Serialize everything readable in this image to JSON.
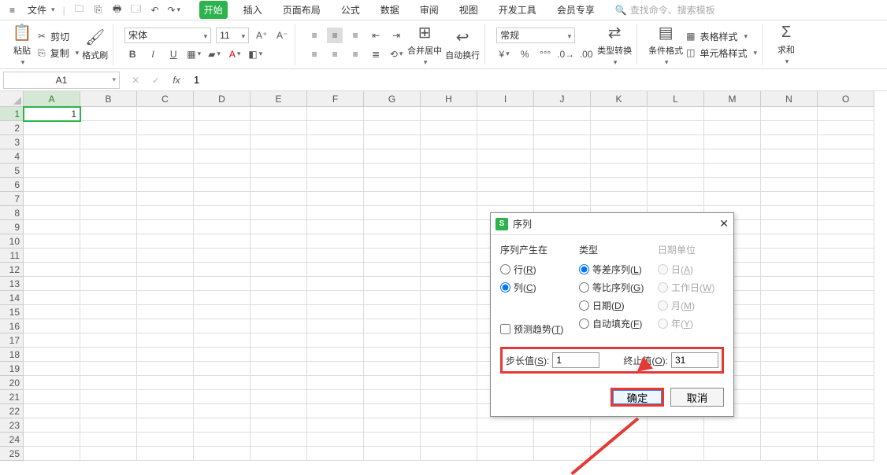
{
  "menubar": {
    "file_label": "文件",
    "tabs": [
      "开始",
      "插入",
      "页面布局",
      "公式",
      "数据",
      "审阅",
      "视图",
      "开发工具",
      "会员专享"
    ],
    "active_tab": "开始",
    "search_placeholder": "查找命令、搜索模板"
  },
  "ribbon": {
    "clipboard": {
      "paste": "粘贴",
      "cut": "剪切",
      "copy": "复制",
      "format_painter": "格式刷"
    },
    "font": {
      "name": "宋体",
      "size": "11",
      "bold": "B",
      "italic": "I",
      "underline": "U"
    },
    "font_size_buttons": {
      "a_plus": "A⁺",
      "a_minus": "A⁻"
    },
    "alignment": {
      "merge": "合并居中"
    },
    "wrap": {
      "label": "自动换行"
    },
    "number": {
      "format": "常规",
      "type_convert": "类型转换"
    },
    "styles": {
      "cond": "条件格式",
      "table_style": "表格样式",
      "cell_style": "单元格样式"
    },
    "editing": {
      "sum": "求和"
    }
  },
  "formula_bar": {
    "name_box": "A1",
    "fx": "fx",
    "formula_value": "1"
  },
  "grid": {
    "columns": [
      "A",
      "B",
      "C",
      "D",
      "E",
      "F",
      "G",
      "H",
      "I",
      "J",
      "K",
      "L",
      "M",
      "N",
      "O"
    ],
    "rows": 25,
    "active_col": 0,
    "active_row": 0,
    "cell_a1": "1"
  },
  "dialog": {
    "title": "序列",
    "section_series_in": "序列产生在",
    "row_label": "行(R)",
    "col_label": "列(C)",
    "series_in_selected": "col",
    "section_type": "类型",
    "type_linear": "等差序列(L)",
    "type_growth": "等比序列(G)",
    "type_date": "日期(D)",
    "type_autofill": "自动填充(F)",
    "type_selected": "linear",
    "section_date_unit": "日期单位",
    "date_day": "日(A)",
    "date_workday": "工作日(W)",
    "date_month": "月(M)",
    "date_year": "年(Y)",
    "trend_label": "预测趋势(T)",
    "step_label": "步长值(S):",
    "step_value": "1",
    "stop_label": "终止值(O):",
    "stop_value": "31",
    "ok": "确定",
    "cancel": "取消"
  }
}
